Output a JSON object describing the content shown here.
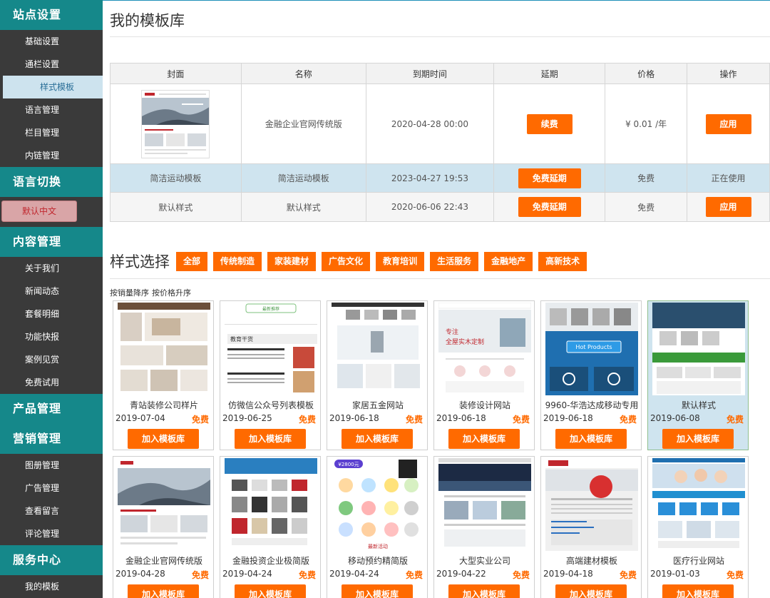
{
  "sidebar": {
    "groups": [
      {
        "title": "站点设置",
        "items": [
          "基础设置",
          "通栏设置",
          "样式模板",
          "语言管理",
          "栏目管理",
          "内链管理"
        ]
      },
      {
        "title": "语言切换",
        "lang": "默认中文"
      },
      {
        "title": "内容管理",
        "items": [
          "关于我们",
          "新闻动态",
          "套餐明细",
          "功能快报",
          "案例见赏",
          "免费试用"
        ]
      },
      {
        "title": "产品管理"
      },
      {
        "title": "营销管理",
        "items": [
          "图册管理",
          "广告管理",
          "查看留言",
          "评论管理"
        ]
      },
      {
        "title": "服务中心",
        "items": [
          "我的模板"
        ]
      }
    ]
  },
  "main": {
    "title": "我的模板库",
    "table": {
      "headers": [
        "封面",
        "名称",
        "到期时间",
        "延期",
        "价格",
        "操作"
      ],
      "rows": [
        {
          "cover": "",
          "name": "金融企业官网传统版",
          "expire": "2020-04-28 00:00",
          "extend": "续费",
          "price": "¥ 0.01 /年",
          "action": "应用"
        },
        {
          "cover": "简洁运动模板",
          "name": "简洁运动模板",
          "expire": "2023-04-27 19:53",
          "extend": "免费延期",
          "price": "免费",
          "action": "正在使用"
        },
        {
          "cover": "默认样式",
          "name": "默认样式",
          "expire": "2020-06-06 22:43",
          "extend": "免费延期",
          "price": "免费",
          "action": "应用"
        }
      ]
    },
    "section_title": "样式选择",
    "categories": [
      "全部",
      "传统制造",
      "家装建材",
      "广告文化",
      "教育培训",
      "生活服务",
      "金融地产",
      "高新技术"
    ],
    "sorts": [
      "按销量降序",
      "按价格升序"
    ],
    "add_label": "加入模板库",
    "templates": [
      {
        "name": "青站装修公司样片",
        "date": "2019-07-04",
        "price": "免费"
      },
      {
        "name": "仿微信公众号列表模板",
        "date": "2019-06-25",
        "price": "免费"
      },
      {
        "name": "家居五金网站",
        "date": "2019-06-18",
        "price": "免费"
      },
      {
        "name": "装修设计网站",
        "date": "2019-06-18",
        "price": "免费"
      },
      {
        "name": "9960-华浩达成移动专用",
        "date": "2019-06-18",
        "price": "免费"
      },
      {
        "name": "默认样式",
        "date": "2019-06-08",
        "price": "免费"
      },
      {
        "name": "金融企业官网传统版",
        "date": "2019-04-28",
        "price": "免费"
      },
      {
        "name": "金融投资企业极简版",
        "date": "2019-04-24",
        "price": "免费"
      },
      {
        "name": "移动预约精简版",
        "date": "2019-04-24",
        "price": "免费"
      },
      {
        "name": "大型实业公司",
        "date": "2019-04-22",
        "price": "免费"
      },
      {
        "name": "高端建材模板",
        "date": "2019-04-18",
        "price": "免费"
      },
      {
        "name": "医疗行业网站",
        "date": "2019-01-03",
        "price": "免费"
      }
    ],
    "thumb_texts": {
      "t2_title": "教育干货",
      "t2_tab": "最新推荐",
      "t4_a": "专注",
      "t4_b": "全屋实木定制",
      "t5_btn": "Hot Products",
      "t9_price": "¥2800元",
      "t9_link": "最新活动"
    },
    "colors": {
      "accent": "#ff6a00",
      "teal": "#15888a",
      "sidebar": "#3a3a3a",
      "highlight": "#cfe4ef"
    }
  }
}
